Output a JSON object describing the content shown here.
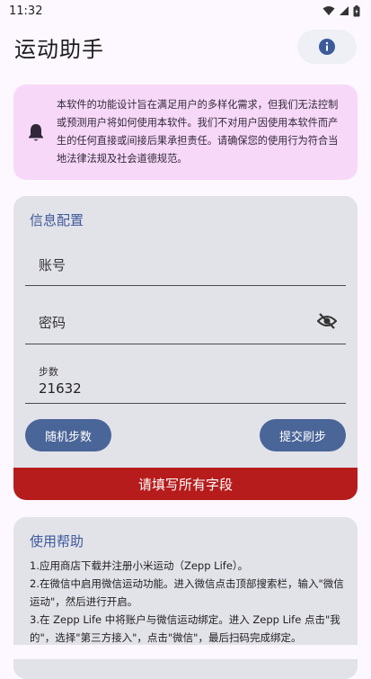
{
  "status_bar": {
    "time": "11:32"
  },
  "app_bar": {
    "title": "运动助手"
  },
  "disclaimer": {
    "text": "本软件的功能设计旨在满足用户的多样化需求，但我们无法控制或预测用户将如何使用本软件。我们不对用户因使用本软件而产生的任何直接或间接后果承担责任。请确保您的使用行为符合当地法律法规及社会道德规范。"
  },
  "config": {
    "title": "信息配置",
    "account_placeholder": "账号",
    "password_placeholder": "密码",
    "steps_label": "步数",
    "steps_value": "21632",
    "random_button": "随机步数",
    "submit_button": "提交刷步",
    "error_message": "请填写所有字段"
  },
  "help": {
    "title": "使用帮助",
    "lines": [
      "1.应用商店下载并注册小米运动（Zepp Life）。",
      "2.在微信中启用微信运动功能。进入微信点击顶部搜索栏，输入\"微信运动\"，然后进行开启。",
      "3.在 Zepp Life 中将账户与微信运动绑定。进入 Zepp Life 点击\"我的\"，选择\"第三方接入\"，点击\"微信\"，最后扫码完成绑定。"
    ]
  },
  "colors": {
    "accent": "#4a6598",
    "error": "#b71c1c",
    "disclaimer_bg": "#f8d8f8",
    "card_bg": "#e2e2e9"
  }
}
